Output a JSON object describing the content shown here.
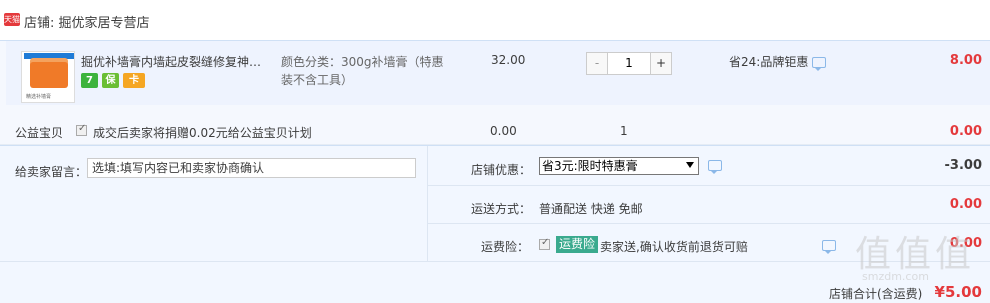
{
  "shop": {
    "badge": "天猫",
    "label": "店铺: 掘优家居专营店"
  },
  "item": {
    "thumb_caption": "精选补墙膏",
    "title": "掘优补墙膏内墙起皮裂缝修复神…",
    "sku": "颜色分类：300g补墙膏（特惠装不含工具）",
    "unit_price": "32.00",
    "quantity": "1",
    "minus_label": "-",
    "plus_label": "+",
    "promo": "省24:品牌钜惠",
    "total": "8.00",
    "service_icons": [
      "7",
      "保",
      "卡"
    ]
  },
  "charity": {
    "label": "公益宝贝",
    "text": "成交后卖家将捐赠0.02元给公益宝贝计划",
    "price": "0.00",
    "qty": "1",
    "total": "0.00"
  },
  "order": {
    "message_label": "给卖家留言：",
    "message_placeholder": "选填:填写内容已和卖家协商确认",
    "discount_label": "店铺优惠：",
    "discount_selected": "省3元:限时特惠膏",
    "discount_total": "-3.00",
    "shipping_label": "运送方式：",
    "shipping_value": "普通配送 快递 免邮",
    "shipping_total": "0.00",
    "insurance_label": "运费险：",
    "insurance_badge": "运费险",
    "insurance_text": "卖家送,确认收货前退货可赔",
    "insurance_total": "0.00",
    "grand_label": "店铺合计(含运费)",
    "grand_total": "¥5.00"
  },
  "watermark": {
    "text": "值值值",
    "sub": "smzdm.com"
  },
  "colors": {
    "accent_red": "#e4393c",
    "row_blue": "#eef3fe",
    "insurance_green": "#3aaa8e"
  }
}
